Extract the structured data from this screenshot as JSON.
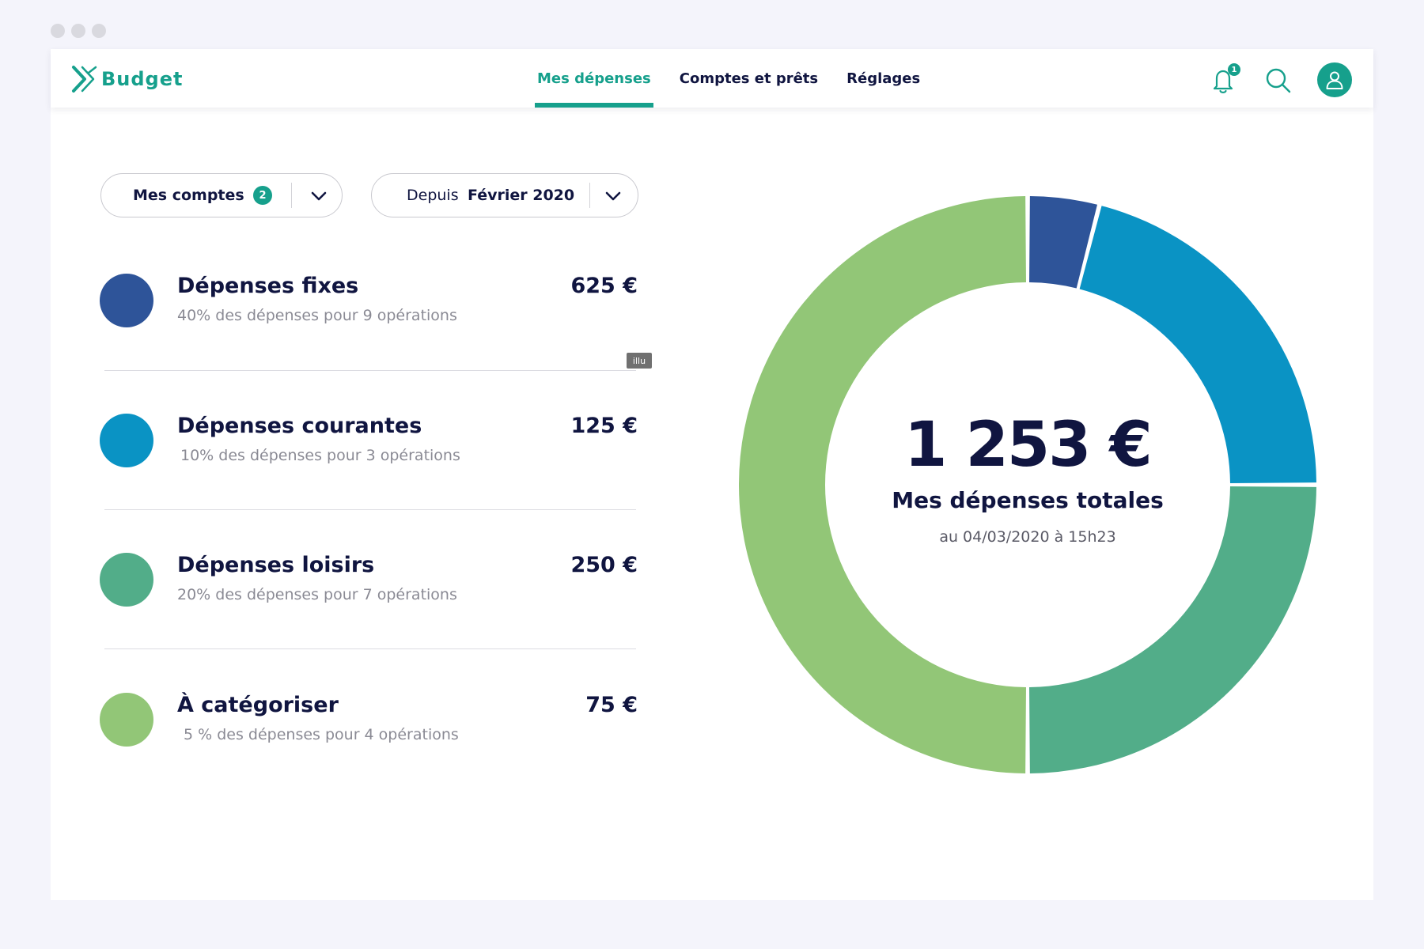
{
  "app": {
    "name": "Budget"
  },
  "nav": {
    "items": [
      {
        "label": "Mes dépenses",
        "active": true
      },
      {
        "label": "Comptes et prêts",
        "active": false
      },
      {
        "label": "Réglages",
        "active": false
      }
    ]
  },
  "header": {
    "notification_count": "1"
  },
  "filters": {
    "accounts": {
      "label": "Mes comptes",
      "count": "2"
    },
    "period": {
      "prefix": "Depuis",
      "value": "Février 2020"
    }
  },
  "categories": [
    {
      "title": "Dépenses fixes",
      "subtitle": "40% des dépenses pour  9 opérations",
      "amount": "625 €",
      "color": "#2e5499"
    },
    {
      "title": "Dépenses courantes",
      "subtitle": "10% des dépenses pour  3 opérations",
      "amount": "125 €",
      "color": "#0a93c4"
    },
    {
      "title": "Dépenses loisirs",
      "subtitle": "20% des dépenses pour  7 opérations",
      "amount": "250 €",
      "color": "#52ad89"
    },
    {
      "title": "À catégoriser",
      "subtitle": "5 % des dépenses pour  4 opérations",
      "amount": "75 €",
      "color": "#92c677"
    }
  ],
  "tag_label": "illu",
  "summary": {
    "total": "1 253 €",
    "label": "Mes dépenses totales",
    "date": "au 04/03/2020 à 15h23"
  },
  "chart_data": {
    "type": "pie",
    "categories": [
      "Dépenses fixes",
      "Dépenses courantes",
      "Dépenses loisirs",
      "À catégoriser"
    ],
    "values": [
      4,
      21,
      25,
      50
    ],
    "colors": [
      "#2e5499",
      "#0a93c4",
      "#52ad89",
      "#92c677"
    ]
  }
}
